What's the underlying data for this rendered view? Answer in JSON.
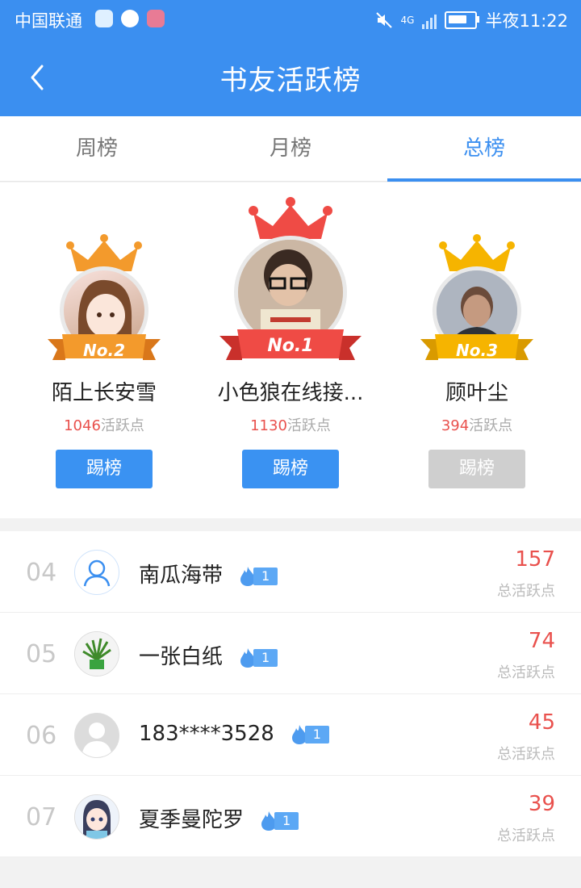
{
  "status": {
    "carrier": "中国联通",
    "network": "4G",
    "time": "半夜11:22"
  },
  "header": {
    "title": "书友活跃榜"
  },
  "tabs": [
    {
      "label": "周榜",
      "active": false
    },
    {
      "label": "月榜",
      "active": false
    },
    {
      "label": "总榜",
      "active": true
    }
  ],
  "podium": {
    "first": {
      "rank_label": "No.1",
      "name": "小色狼在线接...",
      "points": "1130",
      "points_suffix": "活跃点",
      "button": "踢榜"
    },
    "second": {
      "rank_label": "No.2",
      "name": "陌上长安雪",
      "points": "1046",
      "points_suffix": "活跃点",
      "button": "踢榜"
    },
    "third": {
      "rank_label": "No.3",
      "name": "顾叶尘",
      "points": "394",
      "points_suffix": "活跃点",
      "button": "踢榜"
    }
  },
  "list": [
    {
      "rank": "04",
      "name": "南瓜海带",
      "level": "1",
      "score": "157",
      "score_label": "总活跃点"
    },
    {
      "rank": "05",
      "name": "一张白纸",
      "level": "1",
      "score": "74",
      "score_label": "总活跃点"
    },
    {
      "rank": "06",
      "name": "183****3528",
      "level": "1",
      "score": "45",
      "score_label": "总活跃点"
    },
    {
      "rank": "07",
      "name": "夏季曼陀罗",
      "level": "1",
      "score": "39",
      "score_label": "总活跃点"
    }
  ],
  "colors": {
    "primary": "#3b8ff0",
    "score_red": "#e9514d",
    "gold": "#f6b400",
    "orange": "#f39a2c",
    "ribbon_red": "#ef4b45"
  },
  "icons": [
    "back-arrow-icon",
    "mute-icon",
    "signal-icon",
    "battery-icon",
    "crown-icon",
    "flame-icon",
    "default-user-icon"
  ]
}
